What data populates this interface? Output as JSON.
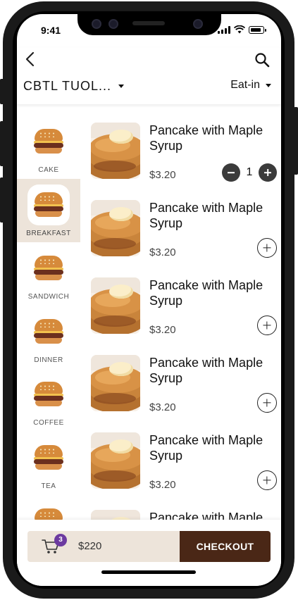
{
  "status_bar": {
    "time": "9:41"
  },
  "header": {
    "store_name": "CBTL TUOL...",
    "dining_mode": "Eat-in"
  },
  "categories": [
    {
      "label": "CAKE",
      "active": false
    },
    {
      "label": "BREAKFAST",
      "active": true
    },
    {
      "label": "SANDWICH",
      "active": false
    },
    {
      "label": "DINNER",
      "active": false
    },
    {
      "label": "COFFEE",
      "active": false
    },
    {
      "label": "TEA",
      "active": false
    }
  ],
  "products": [
    {
      "name": "Pancake with Maple Syrup",
      "price": "$3.20",
      "quantity": "1"
    },
    {
      "name": "Pancake with Maple Syrup",
      "price": "$3.20"
    },
    {
      "name": "Pancake with Maple Syrup",
      "price": "$3.20"
    },
    {
      "name": "Pancake with Maple Syrup",
      "price": "$3.20"
    },
    {
      "name": "Pancake with Maple Syrup",
      "price": "$3.20"
    },
    {
      "name": "Pancake with Maple"
    }
  ],
  "cart": {
    "count": "3",
    "total": "$220",
    "checkout_label": "CHECKOUT"
  },
  "icons": {
    "back": "chevron-left-icon",
    "search": "search-icon",
    "cart": "cart-icon",
    "dropdown": "caret-down-icon"
  },
  "colors": {
    "accent_dark": "#4a2716",
    "active_category_bg": "#ede4da",
    "badge": "#6c3aa0"
  }
}
